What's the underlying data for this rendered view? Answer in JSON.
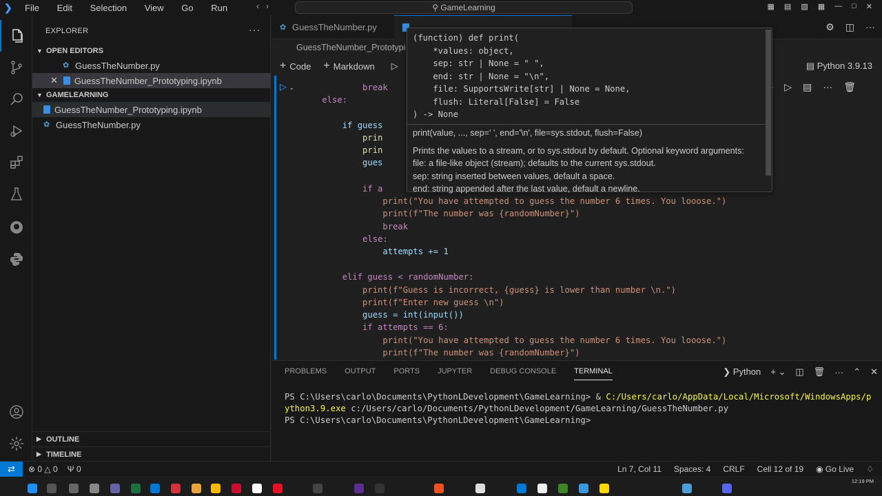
{
  "titlebar": {
    "menu": [
      "File",
      "Edit",
      "Selection",
      "View",
      "Go",
      "Run"
    ],
    "search": "GameLearning"
  },
  "sidebar": {
    "title": "EXPLORER",
    "open_editors_label": "OPEN EDITORS",
    "open_editors": [
      "GuessTheNumber.py",
      "GuessTheNumber_Prototyping.ipynb"
    ],
    "workspace_label": "GAMELEARNING",
    "workspace_files": [
      "GuessTheNumber_Prototyping.ipynb",
      "GuessTheNumber.py"
    ],
    "outline_label": "OUTLINE",
    "timeline_label": "TIMELINE"
  },
  "tabs": [
    {
      "label": "GuessTheNumber.py"
    }
  ],
  "breadcrumb": "GuessTheNumber_Prototypi",
  "toolbar": {
    "code_label": "Code",
    "markdown_label": "Markdown",
    "kernel": "Python 3.9.13"
  },
  "hover": {
    "signature": [
      "(function) def print(",
      "    *values: object,",
      "    sep: str | None = \" \",",
      "    end: str | None = \"\\n\",",
      "    file: SupportsWrite[str] | None = None,",
      "    flush: Literal[False] = False",
      ") -> None"
    ],
    "doc_lines": [
      "print(value, ..., sep=' ', end='\\n', file=sys.stdout, flush=False)",
      "Prints the values to a stream, or to sys.stdout by default. Optional keyword arguments:",
      "file: a file-like object (stream); defaults to the current sys.stdout.",
      "sep: string inserted between values, default a space.",
      "end: string appended after the last value, default a newline."
    ]
  },
  "code_lines": [
    "            break",
    "    else:",
    "        if guess",
    "            prin",
    "            prin",
    "            gues",
    "            if a",
    "                print(\"You have attempted to guess the number 6 times. You looose.\")",
    "                print(f\"The number was {randomNumber}\")",
    "                break",
    "            else:",
    "                attempts += 1",
    "",
    "        elif guess < randomNumber:",
    "            print(f\"Guess is incorrect, {guess} is lower than number \\n.\")",
    "            print(f\"Enter new guess \\n\")",
    "            guess = int(input())",
    "            if attempts == 6:",
    "                print(\"You have attempted to guess the number 6 times. You looose.\")",
    "                print(f\"The number was {randomNumber}\")"
  ],
  "panel": {
    "tabs": [
      "PROBLEMS",
      "OUTPUT",
      "PORTS",
      "JUPYTER",
      "DEBUG CONSOLE",
      "TERMINAL"
    ],
    "active_tab": "TERMINAL",
    "shell": "Python",
    "terminal": {
      "line1_prompt": "PS C:\\Users\\carlo\\Documents\\PythonLDevelopment\\GameLearning> & ",
      "line1_path": "C:/Users/carlo/AppData/Local/Microsoft/WindowsApps/p",
      "line2_path": "ython3.9.exe",
      "line2_rest": " c:/Users/carlo/Documents/PythonLDevelopment/GameLearning/GuessTheNumber.py",
      "line3": "PS C:\\Users\\carlo\\Documents\\PythonLDevelopment\\GameLearning>"
    }
  },
  "status": {
    "errors": "0",
    "warnings": "0",
    "ports": "0",
    "position": "Ln 7, Col 11",
    "spaces": "Spaces: 4",
    "eol": "CRLF",
    "cell": "Cell 12 of 19",
    "golive": "Go Live"
  },
  "taskbar": {
    "time": "12:19 PM"
  }
}
